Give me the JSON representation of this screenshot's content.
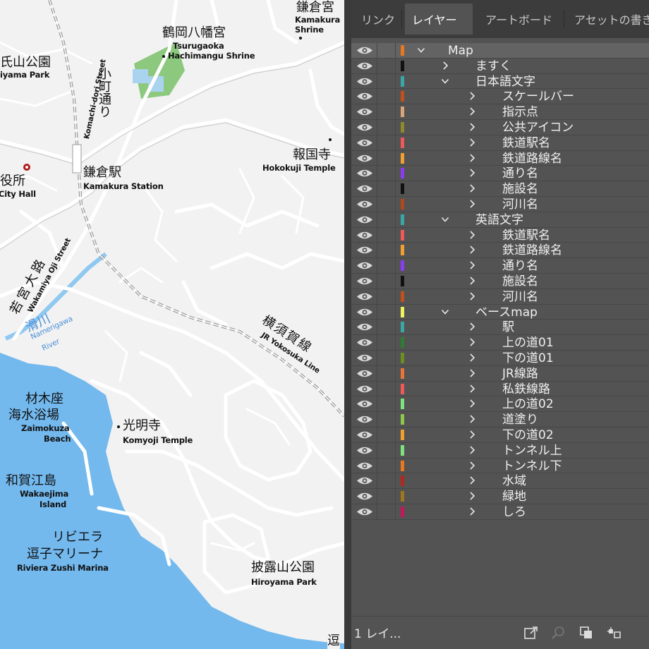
{
  "panel": {
    "tabs": [
      {
        "label": "リンク",
        "active": false
      },
      {
        "label": "レイヤー",
        "active": true
      },
      {
        "label": "アートボード",
        "active": false
      },
      {
        "label": "アセットの書き",
        "active": false
      }
    ],
    "layers": [
      {
        "name": "Map",
        "depth": 0,
        "expanded": true,
        "color": "#e87722",
        "selected": true
      },
      {
        "name": "ますく",
        "depth": 1,
        "expanded": false,
        "color": "#111111"
      },
      {
        "name": "日本語文字",
        "depth": 1,
        "expanded": true,
        "color": "#3aa6a6"
      },
      {
        "name": "スケールバー",
        "depth": 2,
        "expanded": false,
        "color": "#c0501e"
      },
      {
        "name": "指示点",
        "depth": 2,
        "expanded": false,
        "color": "#d8a57a"
      },
      {
        "name": "公共アイコン",
        "depth": 2,
        "expanded": false,
        "color": "#8c8a2a"
      },
      {
        "name": "鉄道駅名",
        "depth": 2,
        "expanded": false,
        "color": "#ee5a5a"
      },
      {
        "name": "鉄道路線名",
        "depth": 2,
        "expanded": false,
        "color": "#f0a030"
      },
      {
        "name": "通り名",
        "depth": 2,
        "expanded": false,
        "color": "#8a3cf0"
      },
      {
        "name": "施設名",
        "depth": 2,
        "expanded": false,
        "color": "#111111"
      },
      {
        "name": "河川名",
        "depth": 2,
        "expanded": false,
        "color": "#b0481e"
      },
      {
        "name": "英語文字",
        "depth": 1,
        "expanded": true,
        "color": "#3aa6a6"
      },
      {
        "name": "鉄道駅名",
        "depth": 2,
        "expanded": false,
        "color": "#ee5a5a"
      },
      {
        "name": "鉄道路線名",
        "depth": 2,
        "expanded": false,
        "color": "#f0a030"
      },
      {
        "name": "通り名",
        "depth": 2,
        "expanded": false,
        "color": "#8a3cf0"
      },
      {
        "name": "施設名",
        "depth": 2,
        "expanded": false,
        "color": "#111111"
      },
      {
        "name": "河川名",
        "depth": 2,
        "expanded": false,
        "color": "#c0501e"
      },
      {
        "name": "ベースmap",
        "depth": 1,
        "expanded": true,
        "color": "#f0f060"
      },
      {
        "name": "駅",
        "depth": 2,
        "expanded": false,
        "color": "#3aa6a6"
      },
      {
        "name": "上の道01",
        "depth": 2,
        "expanded": false,
        "color": "#2e7d32"
      },
      {
        "name": "下の道01",
        "depth": 2,
        "expanded": false,
        "color": "#6b8e23"
      },
      {
        "name": "JR線路",
        "depth": 2,
        "expanded": false,
        "color": "#e8763a"
      },
      {
        "name": "私鉄線路",
        "depth": 2,
        "expanded": false,
        "color": "#ee5a5a"
      },
      {
        "name": "上の道02",
        "depth": 2,
        "expanded": false,
        "color": "#7ee07e"
      },
      {
        "name": "道塗り",
        "depth": 2,
        "expanded": false,
        "color": "#8cc84b"
      },
      {
        "name": "下の道02",
        "depth": 2,
        "expanded": false,
        "color": "#f0a030"
      },
      {
        "name": "トンネル上",
        "depth": 2,
        "expanded": false,
        "color": "#7ee07e"
      },
      {
        "name": "トンネル下",
        "depth": 2,
        "expanded": false,
        "color": "#e87722"
      },
      {
        "name": "水域",
        "depth": 2,
        "expanded": false,
        "color": "#b0281e"
      },
      {
        "name": "緑地",
        "depth": 2,
        "expanded": false,
        "color": "#a0761e"
      },
      {
        "name": "しろ",
        "depth": 2,
        "expanded": false,
        "color": "#c2185b"
      }
    ],
    "footer": {
      "count": "1 レイ...",
      "icons": [
        "export-icon",
        "locate-icon",
        "collect-icon",
        "make-clipping-mask-icon"
      ]
    }
  },
  "map": {
    "labels": [
      {
        "id": "kamakuragu-jp",
        "text": "鎌倉宮"
      },
      {
        "id": "kamakuragu-en1",
        "text": "Kamakura"
      },
      {
        "id": "kamakuragu-en2",
        "text": "Shrine"
      },
      {
        "id": "tsurugaoka-jp",
        "text": "鶴岡八幡宮"
      },
      {
        "id": "tsurugaoka-en1",
        "text": "Tsurugaoka"
      },
      {
        "id": "tsurugaoka-en2",
        "text": "Hachimangu Shrine"
      },
      {
        "id": "genjiyama-jp",
        "text": "氏山公園"
      },
      {
        "id": "genjiyama-en",
        "text": "iyama Park"
      },
      {
        "id": "komachi-jp",
        "text": "小町通り"
      },
      {
        "id": "komachi-en",
        "text": "Komachi-dori Street"
      },
      {
        "id": "hokokuji-jp",
        "text": "報国寺"
      },
      {
        "id": "hokokuji-en",
        "text": "Hokokuji Temple"
      },
      {
        "id": "cityhall-jp",
        "text": "市役所"
      },
      {
        "id": "cityhall-en",
        "text": "City Hall"
      },
      {
        "id": "kamakura-st-jp",
        "text": "鎌倉駅"
      },
      {
        "id": "kamakura-st-en",
        "text": "Kamakura Station"
      },
      {
        "id": "wakamiya-jp",
        "text": "若宮大路"
      },
      {
        "id": "wakamiya-en",
        "text": "Wakamiya Oji Street"
      },
      {
        "id": "yokosuka-jp",
        "text": "横須賀線"
      },
      {
        "id": "yokosuka-en",
        "text": "JR Yokosuka Line"
      },
      {
        "id": "namerigawa-jp",
        "text": "滑川"
      },
      {
        "id": "namerigawa-en1",
        "text": "Namerigawa"
      },
      {
        "id": "namerigawa-en2",
        "text": "River"
      },
      {
        "id": "zaimokuza-jp1",
        "text": "材木座"
      },
      {
        "id": "zaimokuza-jp2",
        "text": "海水浴場"
      },
      {
        "id": "zaimokuza-en1",
        "text": "Zaimokuza"
      },
      {
        "id": "zaimokuza-en2",
        "text": "Beach"
      },
      {
        "id": "komyoji-jp",
        "text": "光明寺"
      },
      {
        "id": "komyoji-en",
        "text": "Komyoji Temple"
      },
      {
        "id": "wakaejima-jp",
        "text": "和賀江島"
      },
      {
        "id": "wakaejima-en1",
        "text": "Wakaejima"
      },
      {
        "id": "wakaejima-en2",
        "text": "Island"
      },
      {
        "id": "riviera-jp1",
        "text": "リビエラ"
      },
      {
        "id": "riviera-jp2",
        "text": "逗子マリーナ"
      },
      {
        "id": "riviera-en",
        "text": "Riviera Zushi Marina"
      },
      {
        "id": "hiroyama-jp",
        "text": "披露山公園"
      },
      {
        "id": "hiroyama-en",
        "text": "Hiroyama Park"
      },
      {
        "id": "edge",
        "text": "逗"
      }
    ]
  }
}
